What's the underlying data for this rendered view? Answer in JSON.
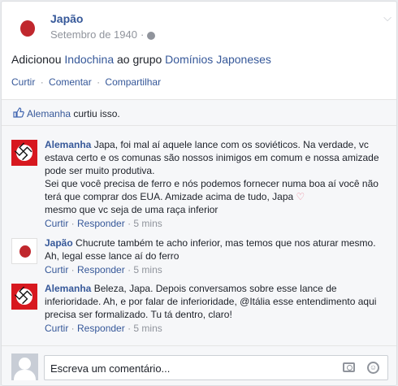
{
  "post": {
    "author": "Japão",
    "date": "Setembro de 1940",
    "date_sep": "·",
    "story": {
      "prefix": "Adicionou ",
      "target": "Indochina",
      "middle": " ao grupo ",
      "group": "Domínios Japoneses"
    },
    "actions": {
      "like": "Curtir",
      "comment": "Comentar",
      "share": "Compartilhar",
      "sep": "·"
    }
  },
  "likes": {
    "who": "Alemanha",
    "text": " curtiu isso."
  },
  "comments": [
    {
      "author": "Alemanha",
      "lines": [
        "Japa, foi mal aí aquele lance com os soviéticos. Na verdade, vc",
        "estava certo e os comunas são nossos inimigos em comum e nossa amizade",
        "pode ser muito produtiva.",
        "Sei que você precisa de ferro e nós podemos fornecer numa boa aí você não",
        "terá que comprar dos EUA. Amizade acima de tudo, Japa",
        "mesmo que vc seja de uma raça inferior"
      ],
      "like": "Curtir",
      "reply": "Responder",
      "time": "5 mins"
    },
    {
      "author": "Japão",
      "lines": [
        "Chucrute também te acho inferior, mas temos que nos aturar mesmo.",
        "Ah, legal esse lance aí do ferro"
      ],
      "like": "Curtir",
      "reply": "Responder",
      "time": "5 mins"
    },
    {
      "author": "Alemanha",
      "lines": [
        "Beleza, Japa. Depois conversamos sobre esse lance de",
        "inferioridade. Ah, e por falar de inferioridade, @Itália esse entendimento aqui",
        "precisa ser formalizado. Tu tá dentro, claro!"
      ],
      "like": "Curtir",
      "reply": "Responder",
      "time": "5 mins"
    }
  ],
  "reply_box": {
    "placeholder": "Escreva um comentário..."
  },
  "icons": {
    "swastika_glyph": "卐",
    "heart_glyph": "♡",
    "chevron_glyph": "⌵",
    "smile_glyph": "☺"
  },
  "colors": {
    "link": "#365899",
    "japan_red": "#c0272d",
    "germany_red": "#d7181f"
  }
}
